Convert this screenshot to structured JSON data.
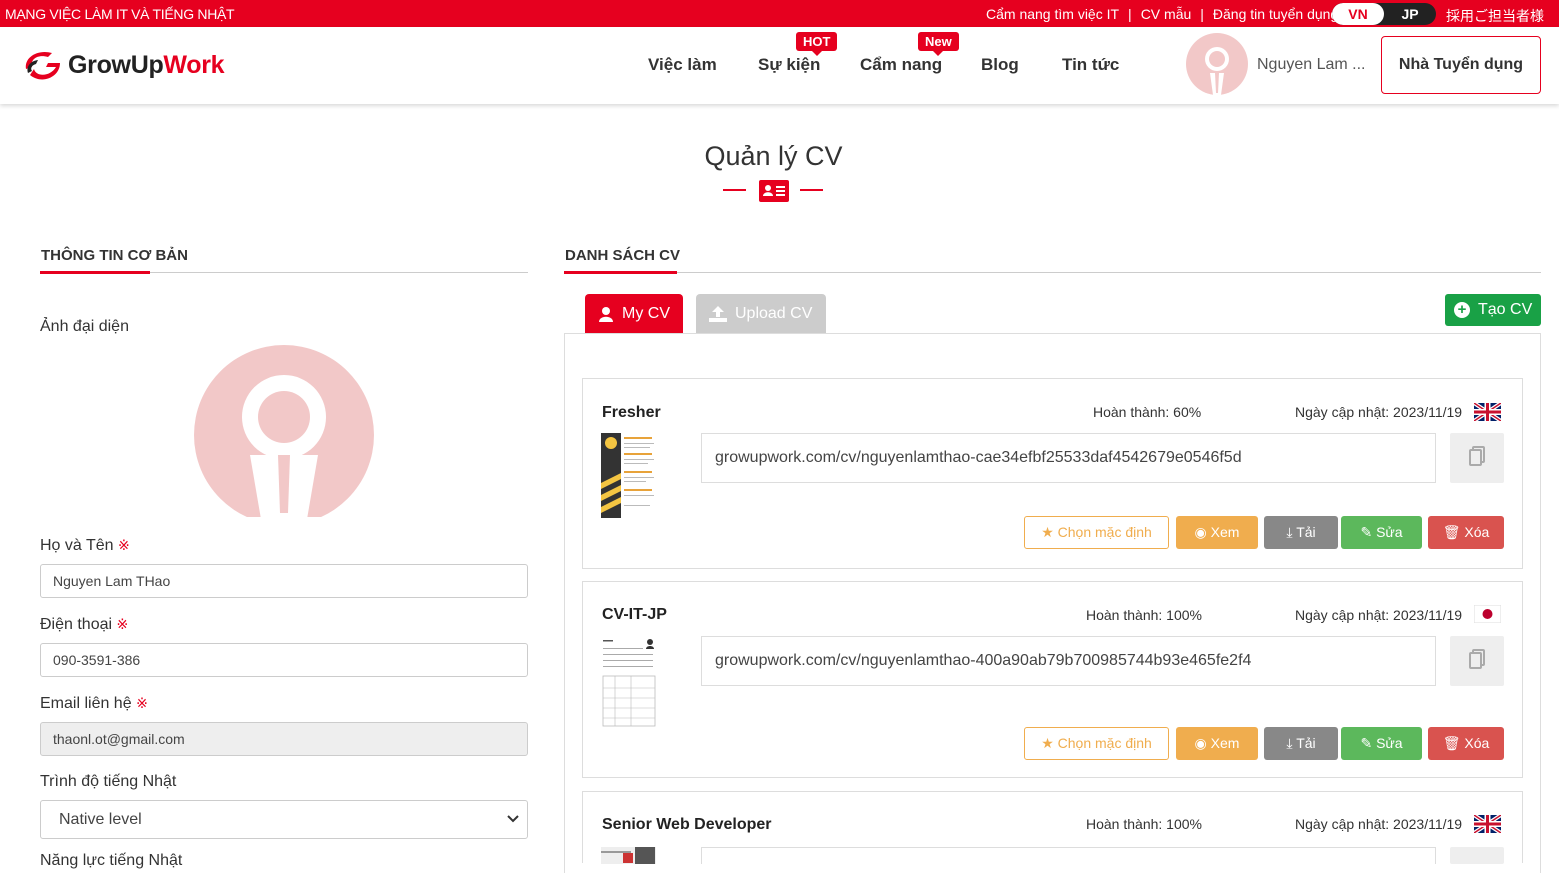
{
  "topbar": {
    "tagline": "MẠNG VIỆC LÀM IT VÀ TIẾNG NHẬT",
    "links": [
      "Cẩm nang tìm việc IT",
      "CV mẫu",
      "Đăng tin tuyển dụng"
    ],
    "lang_vn": "VN",
    "lang_jp": "JP",
    "recruiter_jp": "採用ご担当者様"
  },
  "header": {
    "logo_left": "GrowUp",
    "logo_right": "Work",
    "nav": [
      {
        "label": "Việc làm"
      },
      {
        "label": "Sự kiện",
        "badge": "HOT"
      },
      {
        "label": "Cẩm nang",
        "badge": "New"
      },
      {
        "label": "Blog"
      },
      {
        "label": "Tin tức"
      }
    ],
    "user_name": "Nguyen Lam ...",
    "recruiter_button": "Nhà Tuyển dụng"
  },
  "page": {
    "title": "Quản lý CV"
  },
  "basic_info": {
    "heading": "THÔNG TIN CƠ BẢN",
    "avatar_label": "Ảnh đại diện",
    "required_mark": "※",
    "fullname_label": "Họ và Tên",
    "fullname_value": "Nguyen Lam THao",
    "phone_label": "Điện thoại",
    "phone_value": "090-3591-386",
    "email_label": "Email liên hệ",
    "email_value": "thaonl.ot@gmail.com",
    "japanese_label": "Trình độ tiếng Nhật",
    "japanese_value": "Native level",
    "next_label": "Năng lực tiếng Nhật"
  },
  "cv_list": {
    "heading": "DANH SÁCH CV",
    "tab_my_cv": "My CV",
    "tab_upload": "Upload CV",
    "create_button": "Tạo CV",
    "actions": {
      "default": "Chọn mặc định",
      "view": "Xem",
      "download": "Tải",
      "edit": "Sửa",
      "delete": "Xóa"
    },
    "items": [
      {
        "name": "Fresher",
        "progress": "Hoàn thành: 60%",
        "updated": "Ngày cập nhật: 2023/11/19",
        "flag": "uk-flag",
        "url": "growupwork.com/cv/nguyenlamthao-cae34efbf25533daf4542679e0546f5d"
      },
      {
        "name": "CV-IT-JP",
        "progress": "Hoàn thành: 100%",
        "updated": "Ngày cập nhật: 2023/11/19",
        "flag": "jp-flag",
        "url": "growupwork.com/cv/nguyenlamthao-400a90ab79b700985744b93e465fe2f4"
      },
      {
        "name": "Senior Web Developer",
        "progress": "Hoàn thành: 100%",
        "updated": "Ngày cập nhật: 2023/11/19",
        "flag": "uk-flag",
        "url": ""
      }
    ]
  },
  "colors": {
    "brand_red": "#e6001f",
    "green": "#19a146",
    "orange": "#f0ad4e",
    "gray": "#888888",
    "success": "#5cb85c",
    "danger": "#d9534f"
  }
}
